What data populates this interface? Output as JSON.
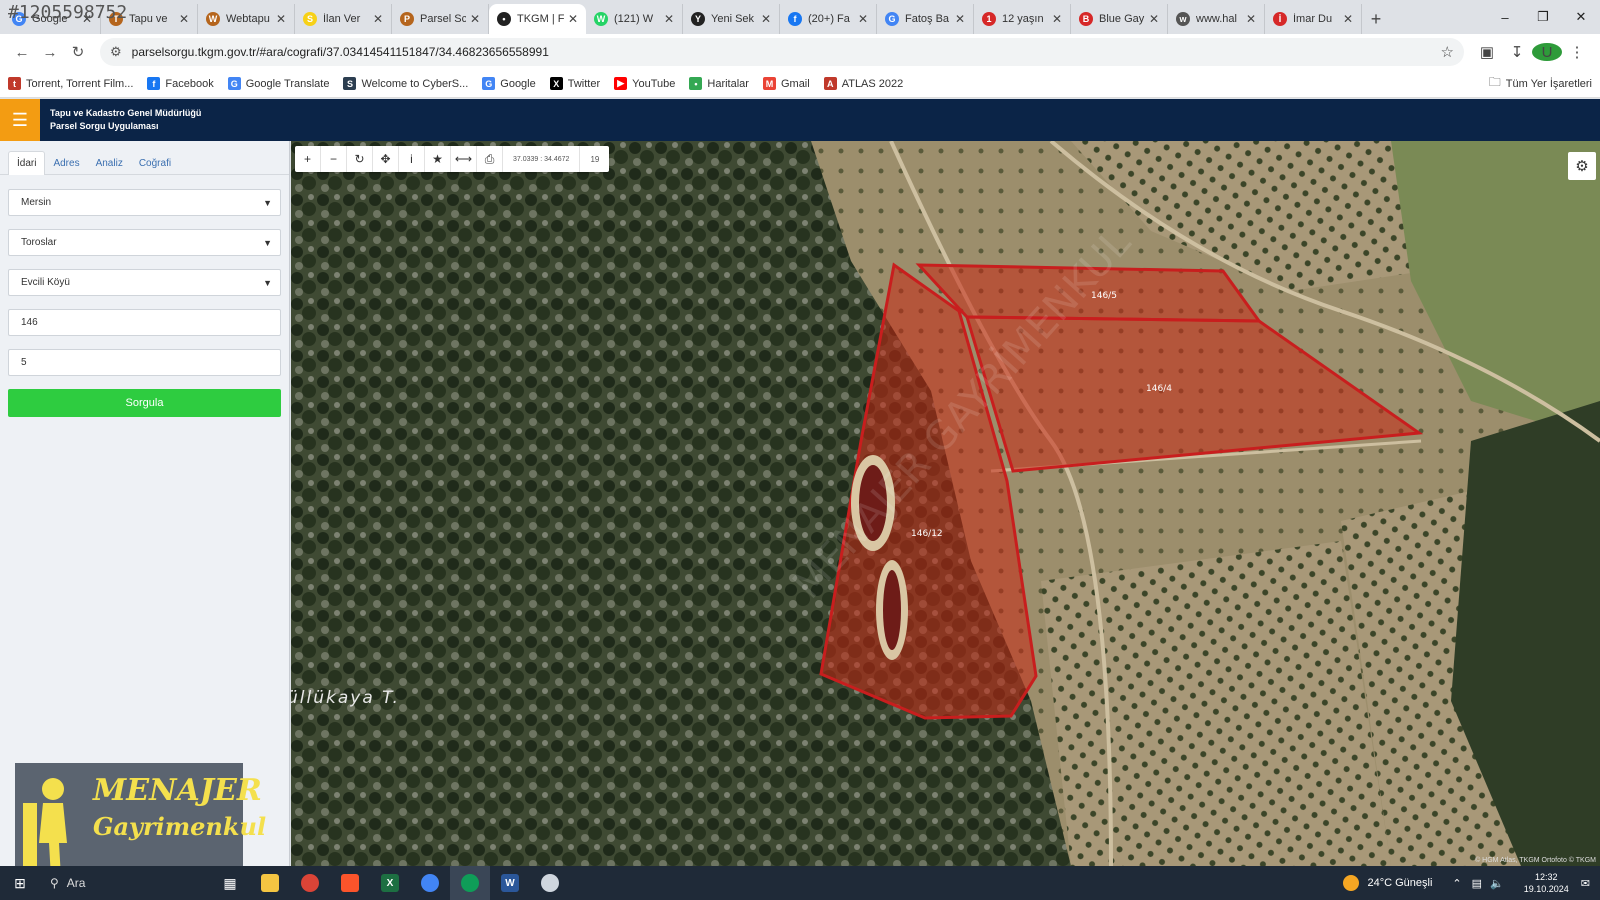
{
  "overlay_id": "#1205598752",
  "browser": {
    "tabs": [
      {
        "label": "Google",
        "icon": "google-icon",
        "color": "#4285f4",
        "glyph": "G"
      },
      {
        "label": "Tapu ve",
        "icon": "tkgm-icon",
        "color": "#b5651d",
        "glyph": "T"
      },
      {
        "label": "Webtapu",
        "icon": "tkgm-icon",
        "color": "#b5651d",
        "glyph": "W"
      },
      {
        "label": "İlan Ver",
        "icon": "sahibinden-icon",
        "color": "#f7d117",
        "glyph": "S"
      },
      {
        "label": "Parsel Sc",
        "icon": "tkgm-icon",
        "color": "#b5651d",
        "glyph": "P"
      },
      {
        "label": "TKGM | F",
        "icon": "location-pin-icon",
        "color": "#222222",
        "glyph": "•"
      },
      {
        "label": "(121) W",
        "icon": "whatsapp-icon",
        "color": "#25d366",
        "glyph": "W"
      },
      {
        "label": "Yeni Sek",
        "icon": "chatgpt-icon",
        "color": "#222222",
        "glyph": "Y"
      },
      {
        "label": "(20+) Fa",
        "icon": "facebook-icon",
        "color": "#1877f2",
        "glyph": "f"
      },
      {
        "label": "Fatoş Ba",
        "icon": "google-icon",
        "color": "#4285f4",
        "glyph": "G"
      },
      {
        "label": "12 yaşın",
        "icon": "news-icon",
        "color": "#d62828",
        "glyph": "1"
      },
      {
        "label": "Blue Gay",
        "icon": "news-icon",
        "color": "#d62828",
        "glyph": "B"
      },
      {
        "label": "www.hal",
        "icon": "globe-icon",
        "color": "#555555",
        "glyph": "w"
      },
      {
        "label": "İmar Du",
        "icon": "news-icon",
        "color": "#d62828",
        "glyph": "İ"
      }
    ],
    "active_tab_index": 5,
    "url": "parselsorgu.tkgm.gov.tr/#ara/cografi/37.03414541151847/34.46823656558991",
    "bookmarks": [
      {
        "label": "Torrent, Torrent Film...",
        "color": "#c0392b",
        "glyph": "t"
      },
      {
        "label": "Facebook",
        "color": "#1877f2",
        "glyph": "f"
      },
      {
        "label": "Google Translate",
        "color": "#4285f4",
        "glyph": "G"
      },
      {
        "label": "Welcome to CyberS...",
        "color": "#2c3e50",
        "glyph": "S"
      },
      {
        "label": "Google",
        "color": "#4285f4",
        "glyph": "G"
      },
      {
        "label": "Twitter",
        "color": "#000000",
        "glyph": "X"
      },
      {
        "label": "YouTube",
        "color": "#ff0000",
        "glyph": "▶"
      },
      {
        "label": "Haritalar",
        "color": "#34a853",
        "glyph": "•"
      },
      {
        "label": "Gmail",
        "color": "#ea4335",
        "glyph": "M"
      },
      {
        "label": "ATLAS 2022",
        "color": "#c0392b",
        "glyph": "A"
      }
    ],
    "all_bookmarks_label": "Tüm Yer İşaretleri"
  },
  "app": {
    "title_line1": "Tapu ve Kadastro Genel Müdürlüğü",
    "title_line2": "Parsel Sorgu Uygulaması",
    "sidebar_tabs": [
      "İdari",
      "Adres",
      "Analiz",
      "Coğrafi"
    ],
    "active_sidebar_tab": 0,
    "fields": {
      "il": "Mersin",
      "ilce": "Toroslar",
      "mahalle": "Evcili Köyü",
      "ada": "146",
      "parsel": "5"
    },
    "query_button": "Sorgula"
  },
  "map": {
    "coord_readout": "37.0339 : 34.4672",
    "zoom_level": "19",
    "parcel_labels": [
      "146/5",
      "146/4",
      "146/12"
    ],
    "place_label": "üllükaya T.",
    "watermark": "MENAJER GAYRİMENKUL",
    "attribution": "© HGM Atlas, TKGM Ortofoto © TKGM"
  },
  "watermark_logo": {
    "line1": "MENAJER",
    "line2": "Gayrimenkul"
  },
  "taskbar": {
    "search_label": "Ara",
    "weather": "24°C  Güneşli",
    "time": "12:32",
    "date": "19.10.2024"
  }
}
